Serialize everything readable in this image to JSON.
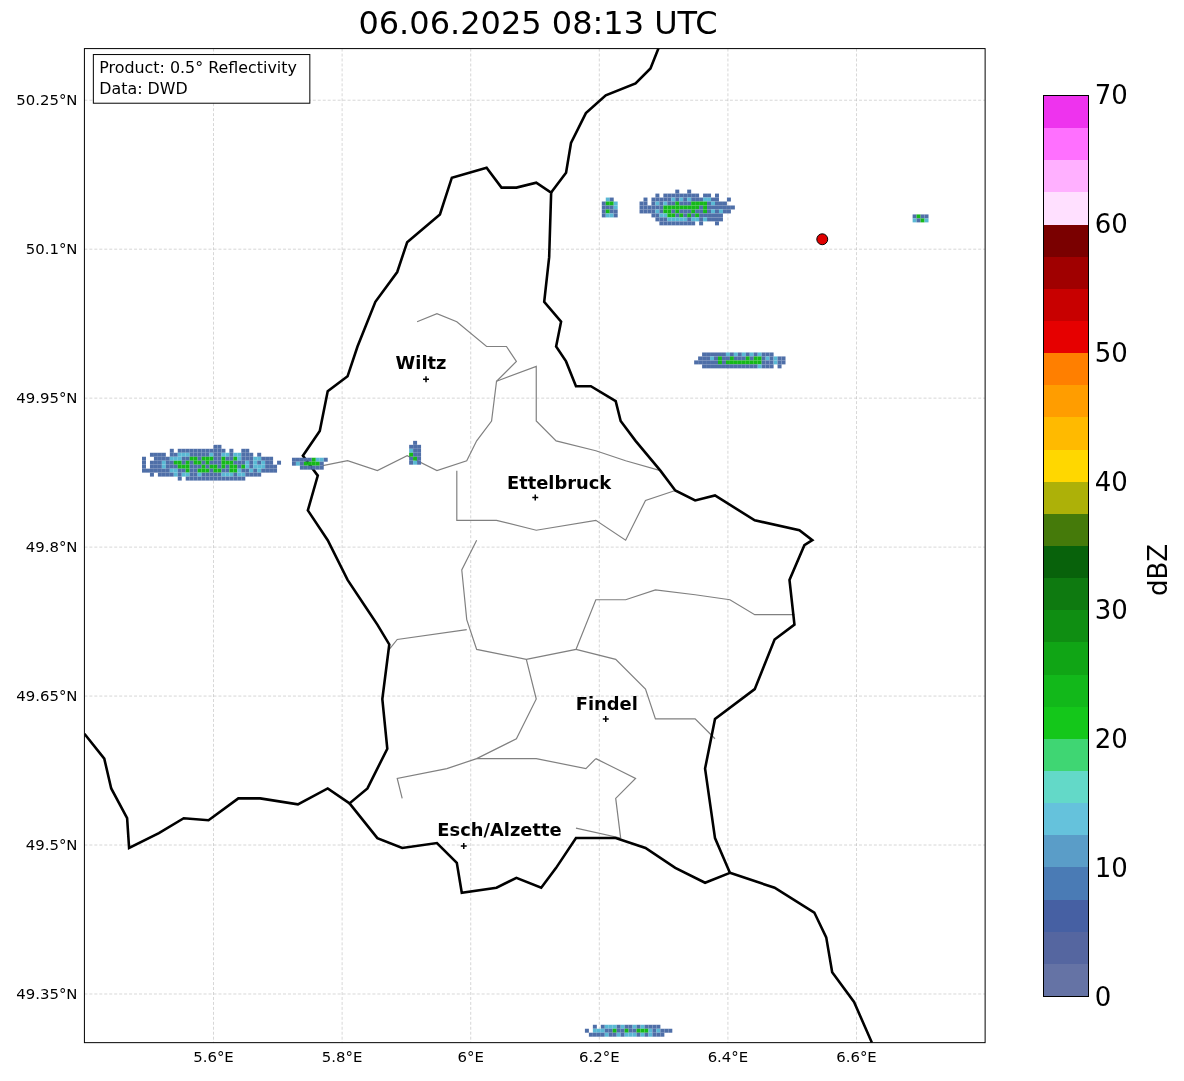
{
  "title": "06.06.2025 08:13 UTC",
  "info_box": {
    "lines": [
      "Product: 0.5° Reflectivity",
      "Data: DWD"
    ]
  },
  "lat_ticks": [
    "50.25°N",
    "50.1°N",
    "49.95°N",
    "49.8°N",
    "49.65°N",
    "49.5°N",
    "49.35°N"
  ],
  "lon_ticks": [
    "5.6°E",
    "5.8°E",
    "6°E",
    "6.2°E",
    "6.4°E",
    "6.6°E"
  ],
  "cities": [
    {
      "name": "Wiltz"
    },
    {
      "name": "Ettelbruck"
    },
    {
      "name": "Findel"
    },
    {
      "name": "Esch/Alzette"
    }
  ],
  "colorbar": {
    "label": "dBZ",
    "ticks": [
      "70",
      "60",
      "50",
      "40",
      "30",
      "20",
      "10",
      "0"
    ],
    "bins": [
      {
        "color": "#6573a5"
      },
      {
        "color": "#5566a0"
      },
      {
        "color": "#4660a3"
      },
      {
        "color": "#4a7bb5"
      },
      {
        "color": "#5a9dc8"
      },
      {
        "color": "#65c2dc"
      },
      {
        "color": "#63d9c8"
      },
      {
        "color": "#3fd673"
      },
      {
        "color": "#14c71a"
      },
      {
        "color": "#12b81a"
      },
      {
        "color": "#10a515"
      },
      {
        "color": "#0f8e12"
      },
      {
        "color": "#0e7a10"
      },
      {
        "color": "#08620b"
      },
      {
        "color": "#457a0a"
      },
      {
        "color": "#adb108"
      },
      {
        "color": "#ffd700"
      },
      {
        "color": "#ffba00"
      },
      {
        "color": "#ff9d00"
      },
      {
        "color": "#ff7f00"
      },
      {
        "color": "#e60000"
      },
      {
        "color": "#c80000"
      },
      {
        "color": "#a00000"
      },
      {
        "color": "#7a0000"
      },
      {
        "color": "#ffe0ff"
      },
      {
        "color": "#ffb0ff"
      },
      {
        "color": "#ff70ff"
      },
      {
        "color": "#ee33ee"
      }
    ]
  }
}
